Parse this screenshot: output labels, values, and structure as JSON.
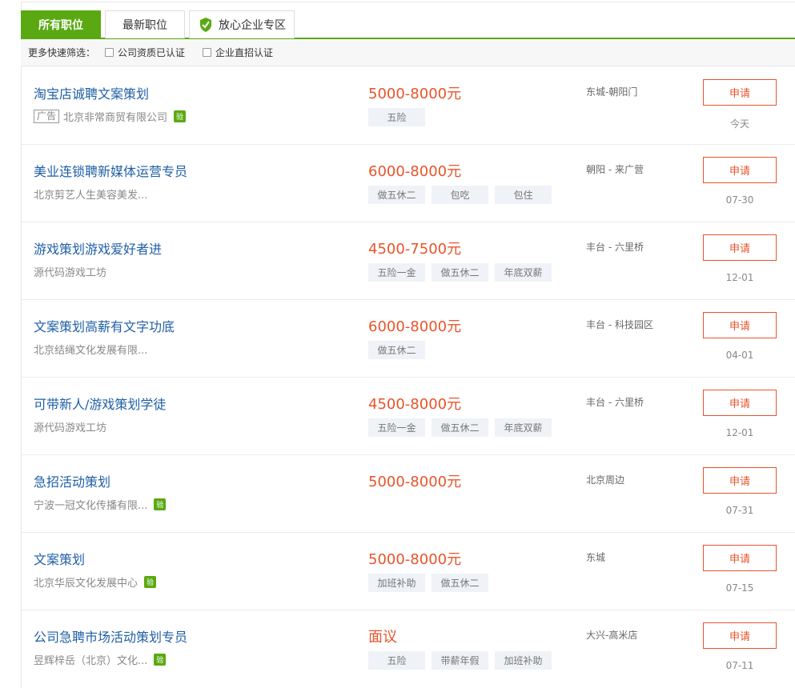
{
  "tabs": [
    {
      "label": "所有职位",
      "active": true
    },
    {
      "label": "最新职位",
      "active": false
    },
    {
      "label": "放心企业专区",
      "active": false,
      "icon": "shield-leaf-icon"
    }
  ],
  "filter": {
    "label": "更多快速筛选：",
    "options": [
      "公司资质已认证",
      "企业直招认证"
    ]
  },
  "colors": {
    "accent_green": "#5aa912",
    "salary_orange": "#e8542b",
    "title_blue": "#1f5fa6"
  },
  "jobs": [
    {
      "title": "淘宝店诚聘文案策划",
      "ad": "广告",
      "company": "北京非常商贸有限公司",
      "verified": true,
      "salary": "5000-8000元",
      "tags": [
        "五险"
      ],
      "location": "东城-朝阳门",
      "apply": "申请",
      "date": "今天"
    },
    {
      "title": "美业连锁聘新媒体运营专员",
      "ad": "",
      "company": "北京剪艺人生美容美发...",
      "verified": false,
      "salary": "6000-8000元",
      "tags": [
        "做五休二",
        "包吃",
        "包住"
      ],
      "location": "朝阳 - 来广营",
      "apply": "申请",
      "date": "07-30"
    },
    {
      "title": "游戏策划游戏爱好者进",
      "ad": "",
      "company": "源代码游戏工坊",
      "verified": false,
      "salary": "4500-7500元",
      "tags": [
        "五险一金",
        "做五休二",
        "年底双薪"
      ],
      "location": "丰台 - 六里桥",
      "apply": "申请",
      "date": "12-01"
    },
    {
      "title": "文案策划高薪有文字功底",
      "ad": "",
      "company": "北京结绳文化发展有限...",
      "verified": false,
      "salary": "6000-8000元",
      "tags": [
        "做五休二"
      ],
      "location": "丰台 - 科技园区",
      "apply": "申请",
      "date": "04-01"
    },
    {
      "title": "可带新人/游戏策划学徒",
      "ad": "",
      "company": "源代码游戏工坊",
      "verified": false,
      "salary": "4500-8000元",
      "tags": [
        "五险一金",
        "做五休二",
        "年底双薪"
      ],
      "location": "丰台 - 六里桥",
      "apply": "申请",
      "date": "12-01"
    },
    {
      "title": "急招活动策划",
      "ad": "",
      "company": "宁波一冠文化传播有限...",
      "verified": true,
      "salary": "5000-8000元",
      "tags": [],
      "location": "北京周边",
      "apply": "申请",
      "date": "07-31"
    },
    {
      "title": "文案策划",
      "ad": "",
      "company": "北京华辰文化发展中心",
      "verified": true,
      "salary": "5000-8000元",
      "tags": [
        "加班补助",
        "做五休二"
      ],
      "location": "东城",
      "apply": "申请",
      "date": "07-15"
    },
    {
      "title": "公司急聘市场活动策划专员",
      "ad": "",
      "company": "昱辉梓岳（北京）文化...",
      "verified": true,
      "salary": "面议",
      "tags": [
        "五险",
        "带薪年假",
        "加班补助"
      ],
      "location": "大兴-高米店",
      "apply": "申请",
      "date": "07-11"
    }
  ],
  "verify_glyph": "验"
}
